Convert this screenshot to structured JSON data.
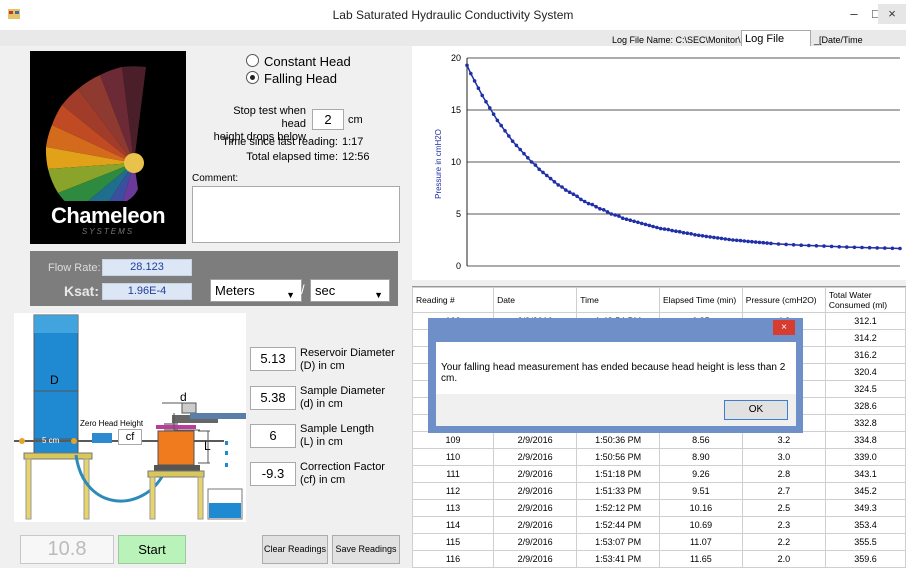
{
  "window": {
    "title": "Lab Saturated Hydraulic Conductivity System",
    "minimize": "–",
    "maximize": "□",
    "close": "×"
  },
  "log": {
    "label": "Log File Name:  C:\\SEC\\Monitor\\",
    "value": "Log File",
    "suffix": "_[Date/Time Stamp].CSV"
  },
  "logo": {
    "word": "Chameleon",
    "sub": "SYSTEMS"
  },
  "mode": {
    "constant_head": "Constant Head",
    "falling_head": "Falling Head",
    "selected": "Falling Head"
  },
  "stop": {
    "label_line1": "Stop test when head",
    "label_line2": "height drops below",
    "value": "2",
    "unit": "cm"
  },
  "timing": {
    "since_label": "Time since last reading:",
    "since_value": "1:17",
    "elapsed_label": "Total elapsed time:",
    "elapsed_value": "12:56"
  },
  "comment": {
    "label": "Comment:",
    "value": ""
  },
  "flow": {
    "flow_label": "Flow Rate:",
    "flow_value": "28.123",
    "ksat_label": "Ksat:",
    "ksat_value": "1.96E-4",
    "unit_length": "Meters",
    "slash": "/",
    "unit_time": "sec"
  },
  "diagram": {
    "d_label": "D",
    "d_small": "d",
    "cf_label": "cf",
    "L_label": "L",
    "zero_head": "Zero Head Height",
    "five_cm": "5 cm"
  },
  "params": [
    {
      "value": "5.13",
      "label1": "Reservoir Diameter",
      "label2": "(D) in cm"
    },
    {
      "value": "5.38",
      "label1": "Sample Diameter",
      "label2": "(d) in cm"
    },
    {
      "value": "6",
      "label1": "Sample Length",
      "label2": "(L) in cm"
    },
    {
      "value": "-9.3",
      "label1": "Correction Factor",
      "label2": "(cf) in cm"
    }
  ],
  "bottom": {
    "reading": "10.8",
    "start": "Start",
    "clear": "Clear Readings",
    "save": "Save Readings"
  },
  "chart_data": {
    "type": "line",
    "title": "",
    "xlabel": "",
    "ylabel": "Pressure in cmH2O",
    "ylim": [
      0,
      20
    ],
    "yticks": [
      "0",
      "5",
      "10",
      "15",
      "20"
    ],
    "grid": true,
    "series": [
      {
        "color": "#1f2fa8",
        "x": [
          0,
          0.5,
          1,
          1.5,
          2,
          2.5,
          3,
          3.5,
          4,
          4.5,
          5,
          5.5,
          6,
          6.5,
          7,
          7.5,
          8,
          8.5,
          9,
          9.5,
          10,
          10.5,
          11,
          11.5,
          12,
          12.5,
          13,
          13.5,
          14,
          14.5,
          15,
          15.5,
          16,
          16.5,
          17,
          17.5,
          18,
          18.5,
          19,
          19.5,
          20,
          20.5,
          21,
          21.5,
          22,
          22.5,
          23,
          23.5,
          24,
          24.5,
          25,
          25.5,
          26,
          26.5,
          27,
          27.5,
          28,
          28.5,
          29,
          29.5,
          30,
          30.5,
          31,
          31.5,
          32,
          32.5,
          33,
          33.5,
          34,
          34.5,
          35,
          35.5,
          36,
          36.5,
          37,
          37.5,
          38,
          38.5,
          39,
          39.5,
          40,
          41,
          42,
          43,
          44,
          45,
          46,
          47,
          48,
          49,
          50,
          51,
          52,
          53,
          54,
          55,
          56,
          57
        ],
        "y": [
          19.3,
          18.5,
          17.8,
          17.1,
          16.4,
          15.8,
          15.2,
          14.6,
          14.0,
          13.5,
          13.0,
          12.5,
          12.0,
          11.6,
          11.2,
          10.8,
          10.4,
          10.0,
          9.7,
          9.3,
          9.0,
          8.7,
          8.4,
          8.1,
          7.8,
          7.6,
          7.3,
          7.1,
          6.9,
          6.7,
          6.4,
          6.2,
          6.0,
          5.9,
          5.7,
          5.5,
          5.4,
          5.2,
          5.0,
          4.9,
          4.8,
          4.6,
          4.5,
          4.4,
          4.3,
          4.2,
          4.1,
          4.0,
          3.9,
          3.8,
          3.7,
          3.6,
          3.55,
          3.5,
          3.4,
          3.35,
          3.3,
          3.2,
          3.15,
          3.1,
          3.0,
          2.95,
          2.9,
          2.85,
          2.8,
          2.75,
          2.7,
          2.65,
          2.6,
          2.55,
          2.5,
          2.47,
          2.44,
          2.4,
          2.37,
          2.34,
          2.3,
          2.27,
          2.24,
          2.2,
          2.17,
          2.12,
          2.08,
          2.04,
          2.0,
          1.97,
          1.94,
          1.91,
          1.88,
          1.85,
          1.82,
          1.8,
          1.78,
          1.76,
          1.74,
          1.72,
          1.7,
          1.68
        ]
      }
    ]
  },
  "table": {
    "headers": [
      "Reading #",
      "Date",
      "Time",
      "Elapsed Time (min)",
      "Pressure (cmH2O)",
      "Total Water Consumed (ml)"
    ],
    "rows": [
      [
        "102",
        "2/9/2016",
        "1:48:54 PM",
        "6.85",
        "4.3",
        "312.1"
      ],
      [
        "",
        "",
        "",
        "",
        "",
        "314.2"
      ],
      [
        "",
        "",
        "",
        "",
        "",
        "316.2"
      ],
      [
        "",
        "",
        "",
        "",
        "",
        "320.4"
      ],
      [
        "",
        "",
        "",
        "",
        "",
        "324.5"
      ],
      [
        "",
        "",
        "",
        "",
        "",
        "328.6"
      ],
      [
        "",
        "",
        "",
        "",
        "",
        "332.8"
      ],
      [
        "109",
        "2/9/2016",
        "1:50:36 PM",
        "8.56",
        "3.2",
        "334.8"
      ],
      [
        "110",
        "2/9/2016",
        "1:50:56 PM",
        "8.90",
        "3.0",
        "339.0"
      ],
      [
        "111",
        "2/9/2016",
        "1:51:18 PM",
        "9.26",
        "2.8",
        "343.1"
      ],
      [
        "112",
        "2/9/2016",
        "1:51:33 PM",
        "9.51",
        "2.7",
        "345.2"
      ],
      [
        "113",
        "2/9/2016",
        "1:52:12 PM",
        "10.16",
        "2.5",
        "349.3"
      ],
      [
        "114",
        "2/9/2016",
        "1:52:44 PM",
        "10.69",
        "2.3",
        "353.4"
      ],
      [
        "115",
        "2/9/2016",
        "1:53:07 PM",
        "11.07",
        "2.2",
        "355.5"
      ],
      [
        "116",
        "2/9/2016",
        "1:53:41 PM",
        "11.65",
        "2.0",
        "359.6"
      ]
    ]
  },
  "dialog": {
    "message": "Your falling head measurement has ended because head height is less than 2 cm.",
    "ok": "OK",
    "close": "×"
  }
}
